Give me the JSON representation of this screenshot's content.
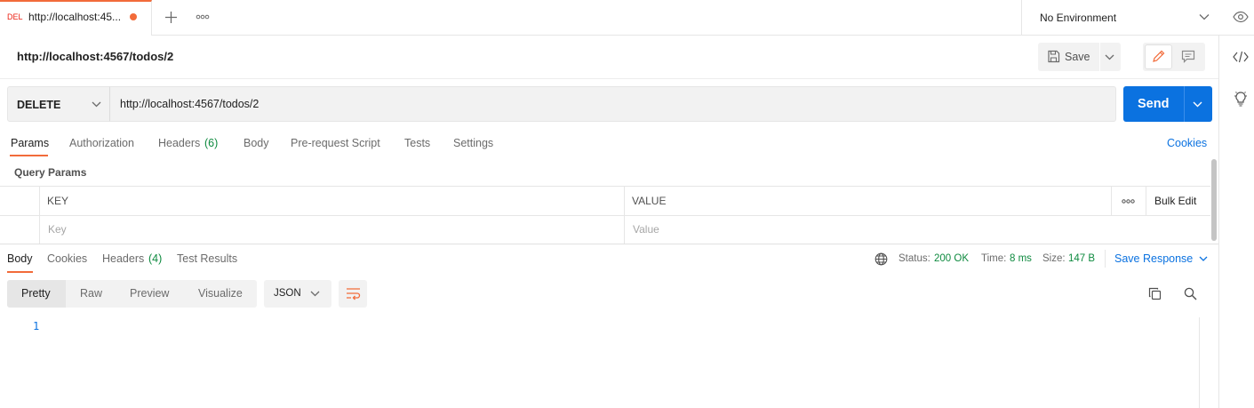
{
  "tab": {
    "method": "DEL",
    "title": "http://localhost:45...",
    "new_tab_glyph": "+",
    "more_glyph": "∘∘∘"
  },
  "environment": {
    "label": "No Environment"
  },
  "request": {
    "title": "http://localhost:4567/todos/2",
    "save_label": "Save",
    "method": "DELETE",
    "url": "http://localhost:4567/todos/2",
    "send_label": "Send"
  },
  "request_tabs": [
    {
      "label": "Params",
      "active": true
    },
    {
      "label": "Authorization"
    },
    {
      "label": "Headers",
      "count": "(6)"
    },
    {
      "label": "Body"
    },
    {
      "label": "Pre-request Script"
    },
    {
      "label": "Tests"
    },
    {
      "label": "Settings"
    }
  ],
  "cookies_label": "Cookies",
  "query_params": {
    "heading": "Query Params",
    "key_header": "KEY",
    "value_header": "VALUE",
    "more_glyph": "∘∘∘",
    "bulk_edit": "Bulk Edit",
    "key_placeholder": "Key",
    "value_placeholder": "Value"
  },
  "response_tabs": [
    {
      "label": "Body",
      "active": true
    },
    {
      "label": "Cookies"
    },
    {
      "label": "Headers",
      "count": "(4)"
    },
    {
      "label": "Test Results"
    }
  ],
  "response_meta": {
    "status_label": "Status:",
    "status_value": "200 OK",
    "time_label": "Time:",
    "time_value": "8 ms",
    "size_label": "Size:",
    "size_value": "147 B",
    "save_response": "Save Response"
  },
  "body_formats": [
    "Pretty",
    "Raw",
    "Preview",
    "Visualize"
  ],
  "body_language": "JSON",
  "editor": {
    "line_numbers": [
      "1"
    ]
  },
  "colors": {
    "accent": "#f26b3a",
    "primary": "#0b72e0",
    "status_ok": "#0e8a3f",
    "delete_method": "#eb2013"
  },
  "icons": [
    "eye-icon",
    "code-icon",
    "lightbulb-icon",
    "save-icon",
    "pencil-icon",
    "comment-icon",
    "globe-icon",
    "wrap-lines-icon",
    "copy-icon",
    "search-icon",
    "chevron-down-icon",
    "plus-icon",
    "more-icon"
  ]
}
